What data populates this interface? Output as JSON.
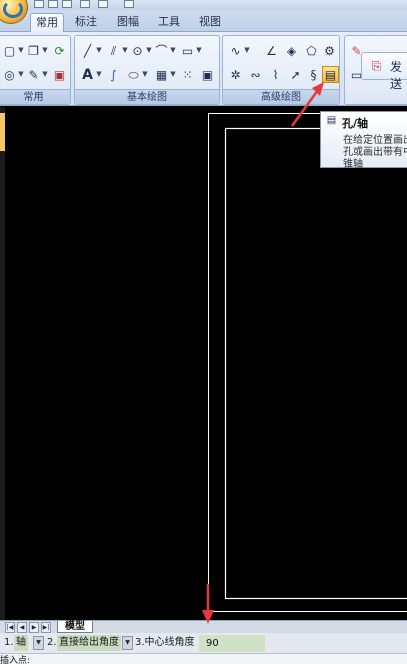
{
  "ribbon": {
    "tabs": [
      "常用",
      "标注",
      "图幅",
      "工具",
      "视图"
    ],
    "active_tab": "常用",
    "groups": {
      "common": "常用",
      "basic_draw": "基本绘图",
      "advanced_draw": "高级绘图"
    },
    "publish_button": "发送"
  },
  "tooltip": {
    "title": "孔/轴",
    "lines": [
      "在给定位置画出",
      "孔或画出带有中",
      "锥轴"
    ]
  },
  "drawing": {
    "frame_color": "#ffffff",
    "background_color": "#000000",
    "annotation_color": "#e5393b"
  },
  "model_tabs": {
    "active": "模型"
  },
  "command_options": {
    "opt1_index": "1.",
    "opt1_value": "轴",
    "opt2_index": "2.",
    "opt2_value": "直接给出角度",
    "opt3_label": "3.中心线角度",
    "angle_value": "90"
  },
  "status": {
    "prompt": "插入点:"
  }
}
